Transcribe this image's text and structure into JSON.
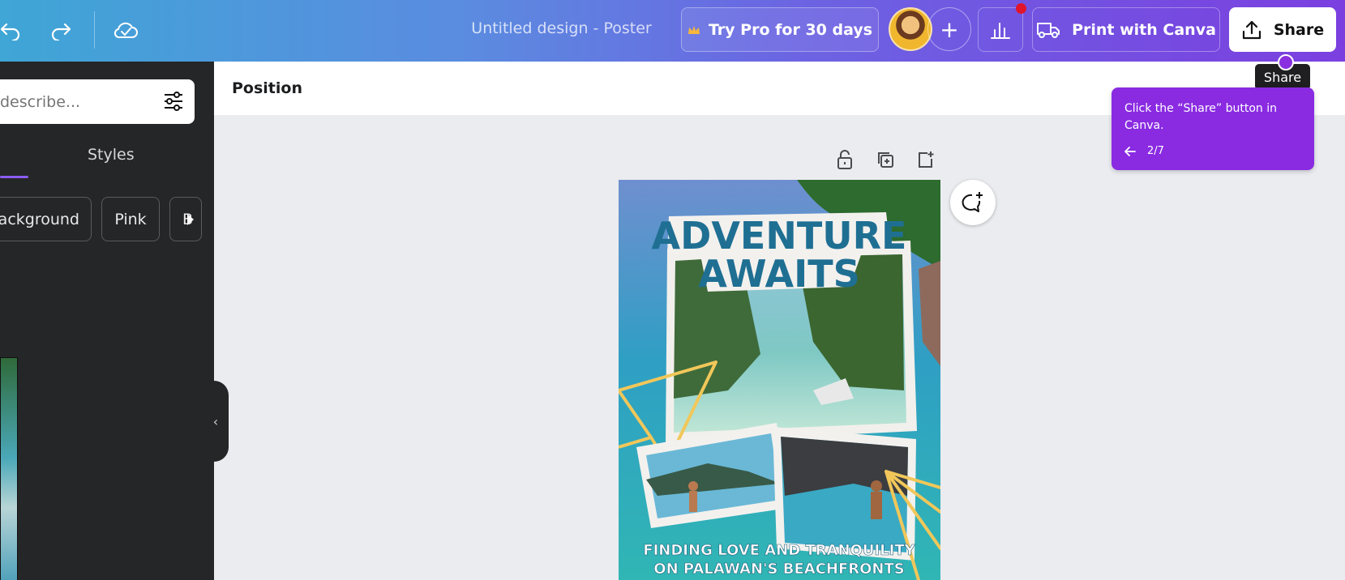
{
  "topbar": {
    "undo_icon": "undo-icon",
    "redo_icon": "redo-icon",
    "save_status_icon": "cloud-check-icon",
    "document_title": "Untitled design - Poster",
    "pro_button": "Try Pro for 30 days",
    "add_collaborator": "+",
    "print_button": "Print with Canva",
    "share_button": "Share"
  },
  "left_panel": {
    "search_placeholder": "describe...",
    "tab_styles": "Styles",
    "chips": [
      "ackground",
      "Pink",
      "B"
    ]
  },
  "canvas": {
    "position_label": "Position"
  },
  "poster": {
    "title_line1": "ADVENTURE",
    "title_line2": "AWAITS",
    "subtitle_line1": "FINDING LOVE AND TRANQUILITY",
    "subtitle_line2": "ON PALAWAN'S BEACHFRONTS"
  },
  "guide": {
    "tooltip": "Share",
    "text": "Click the “Share” button in Canva.",
    "step": "2/7"
  },
  "colors": {
    "accent_purple": "#8a2be2",
    "notification": "#e0152b",
    "poster_title": "#1f6f93"
  }
}
